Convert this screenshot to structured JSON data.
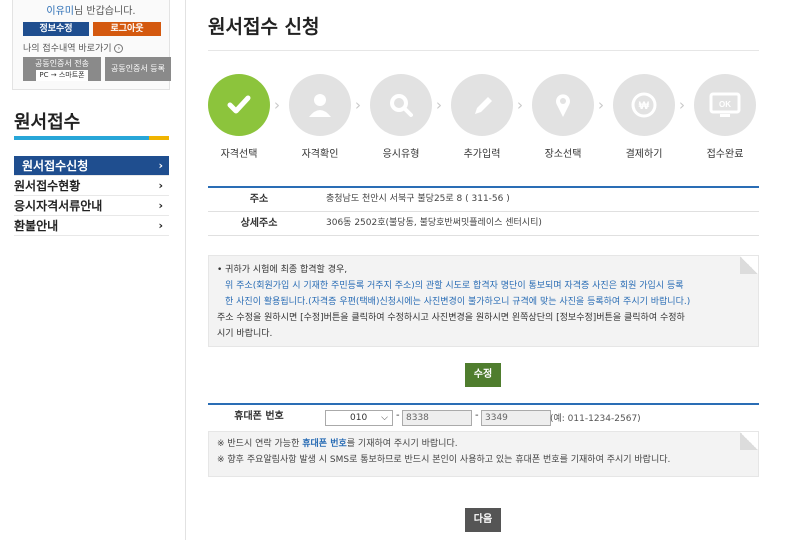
{
  "user": {
    "name": "이유미",
    "welcome_suffix": "님 반갑습니다.",
    "info_btn": "정보수정",
    "logout_btn": "로그아웃",
    "shortcut": "나의 접수내역 바로가기",
    "cert_send_line1": "공동인증서 전송",
    "cert_send_line2": "PC → 스마트폰",
    "cert_register": "공동인증서 등록"
  },
  "lnb": {
    "title": "원서접수",
    "items": [
      {
        "label": "원서접수신청"
      },
      {
        "label": "원서접수현황"
      },
      {
        "label": "응시자격서류안내"
      },
      {
        "label": "환불안내"
      }
    ]
  },
  "page": {
    "title": "원서접수 신청"
  },
  "steps": [
    {
      "label": "자격선택",
      "icon": "check-icon"
    },
    {
      "label": "자격확인",
      "icon": "person-icon"
    },
    {
      "label": "응시유형",
      "icon": "magnifier-icon"
    },
    {
      "label": "추가입력",
      "icon": "pencil-icon"
    },
    {
      "label": "장소선택",
      "icon": "location-pin-icon"
    },
    {
      "label": "결제하기",
      "icon": "won-coin-icon"
    },
    {
      "label": "접수완료",
      "icon": "ok-monitor-icon"
    }
  ],
  "address": {
    "label": "주소",
    "value": "충청남도 천안시 서북구 불당25로 8 ( 311-56 )",
    "detail_label": "상세주소",
    "detail_value": "306동 2502호(불당동, 불당호반써밋플레이스 센터시티)"
  },
  "notice": {
    "line1": "• 귀하가 시험에 최종 합격할 경우,",
    "line2": "위 주소(회원가입 시 기재한 주민등록 거주지 주소)의 관할 시도로 합격자 명단이 통보되며 자격증 사진은 회원 가입시 등록",
    "line3": "한 사진이 활용됩니다.(자격증 우편(택배)신청시에는 사진변경이 불가하오니 규격에 맞는 사진을 등록하여 주시기 바랍니다.)",
    "line4": "주소 수정을 원하시면 [수정]버튼을 클릭하여 수정하시고 사진변경을 원하시면 왼쪽상단의 [정보수정]버튼을 클릭하여 수정하",
    "line5": "시기 바랍니다."
  },
  "edit_btn": "수정",
  "phone": {
    "label": "휴대폰 번호",
    "prefix": "010",
    "mid": "8338",
    "last": "3349",
    "example": "(예: 011-1234-2567)"
  },
  "notice2": {
    "line1_pre": "※ 반드시 연락 가능한 ",
    "line1_em": "휴대폰 번호",
    "line1_post": "를 기재하여 주시기 바랍니다.",
    "line2": "※ 향후 주요알림사항 발생 시 SMS로 통보하므로 반드시 본인이 사용하고 있는 휴대폰 번호를 기재하여 주시기 바랍니다."
  },
  "next_btn": "다음",
  "colors": {
    "accent": "#1f4e8f",
    "step_active": "#8cc43c",
    "blue_text": "#2a6db5"
  }
}
